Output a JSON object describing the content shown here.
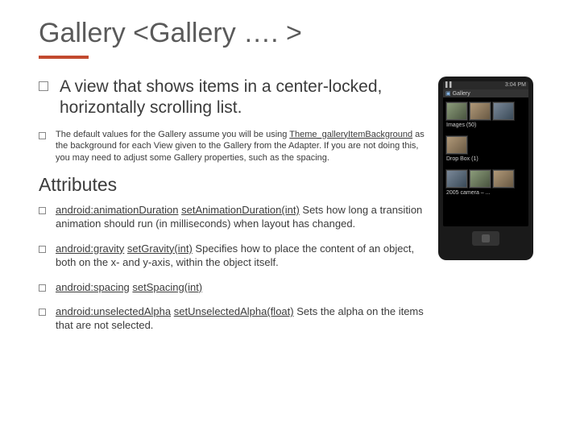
{
  "title": "Gallery  <Gallery …. >",
  "main_bullet": "A view that shows items in a center-locked, horizontally scrolling list.",
  "sub_bullet_prefix": "The default values for the Gallery assume you will be using ",
  "sub_bullet_link": "Theme_galleryItemBackground",
  "sub_bullet_suffix": " as the background for each View given to the Gallery from the Adapter. If you are not doing this, you may need to adjust some Gallery properties, such as the spacing.",
  "attributes_heading": "Attributes",
  "attrs": [
    {
      "link1": "android:animationDuration",
      "link2": "setAnimationDuration(int)",
      "desc": " Sets how long a transition animation should run (in milliseconds) when layout has changed."
    },
    {
      "link1": "android:gravity",
      "link2": "setGravity(int)",
      "desc": " Specifies how to place the content of an object, both on the x- and y-axis, within the object itself."
    },
    {
      "link1": "android:spacing",
      "link2": "setSpacing(int)",
      "desc": ""
    },
    {
      "link1": "android:unselectedAlpha",
      "link2": "setUnselectedAlpha(float)",
      "desc": " Sets the alpha on the items that are not selected."
    }
  ],
  "phone": {
    "status_left": "▌▌",
    "status_right": "3:04 PM",
    "bar_label": "Gallery",
    "section1_caption": "Images (50)",
    "section2_caption": "Drop Box (1)",
    "section3_caption": "2005 camera – ..."
  }
}
